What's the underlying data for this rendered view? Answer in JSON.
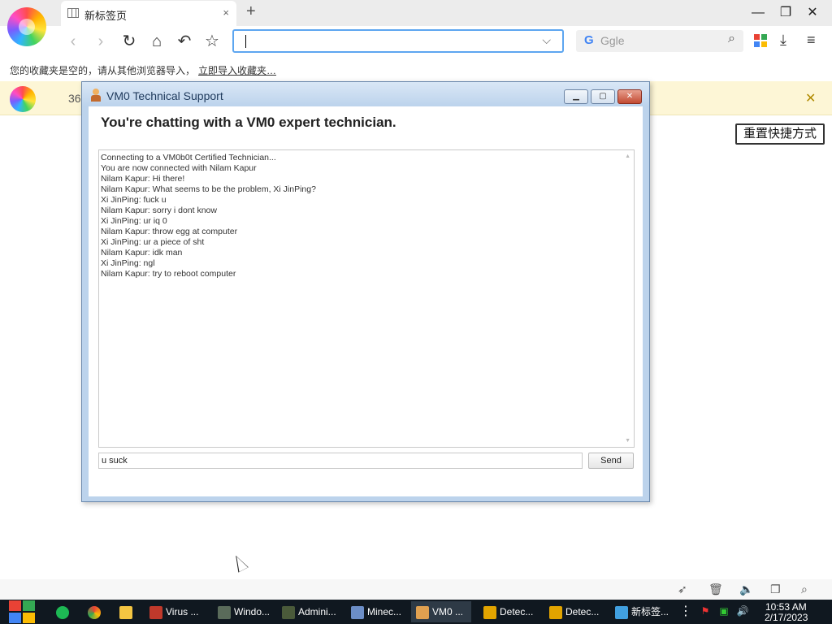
{
  "browser": {
    "tab_title": "新标签页",
    "tab_close": "×",
    "new_tab": "+",
    "address_value": "",
    "search_engine_letter": "G",
    "search_placeholder": "Ggle",
    "window_controls": {
      "minimize": "—",
      "restore": "❐",
      "close": "✕"
    },
    "icons": {
      "back": "chevron-left-icon",
      "forward": "chevron-right-icon",
      "reload": "reload-icon",
      "home": "home-icon",
      "undo": "undo-icon",
      "star": "star-icon"
    }
  },
  "bookmarks": {
    "empty_text": "您的收藏夹是空的，请从其他浏览器导入，",
    "import_link": "立即导入收藏夹…"
  },
  "banner": {
    "text": "36",
    "close": "✕"
  },
  "page": {
    "reset_shortcuts": "重置快捷方式"
  },
  "dialog": {
    "title": "VM0 Technical Support",
    "heading": "You're chatting with a VM0 expert technician.",
    "chat_lines": [
      "Connecting to a VM0b0t Certified Technician...",
      "You are now connected with Nilam Kapur",
      "Nilam Kapur: Hi there!",
      "Nilam Kapur: What seems to be the problem, Xi JinPing?",
      "Xi JinPing: fuck u",
      "Nilam Kapur: sorry i dont know",
      "Xi JinPing: ur iq 0",
      "Nilam Kapur: throw egg at computer",
      "Xi JinPing: ur a piece of sht",
      "Nilam Kapur: idk man",
      "Xi JinPing: ngl",
      "Nilam Kapur: try to reboot computer"
    ],
    "message_value": "u suck",
    "send_label": "Send"
  },
  "taskbar": {
    "items": [
      {
        "label": "Virus ...",
        "color": "#c0392b"
      },
      {
        "label": "Windo...",
        "color": "#5a6b5a"
      },
      {
        "label": "Admini...",
        "color": "#4a5a3a"
      },
      {
        "label": "Minec...",
        "color": "#6c8ec7"
      },
      {
        "label": "VM0 ...",
        "color": "#e0a050"
      },
      {
        "label": "Detec...",
        "color": "#e2a400"
      },
      {
        "label": "Detec...",
        "color": "#e2a400"
      },
      {
        "label": "新标签...",
        "color": "#41a0e0"
      }
    ],
    "clock_time": "10:53 AM",
    "clock_date": "2/17/2023"
  }
}
